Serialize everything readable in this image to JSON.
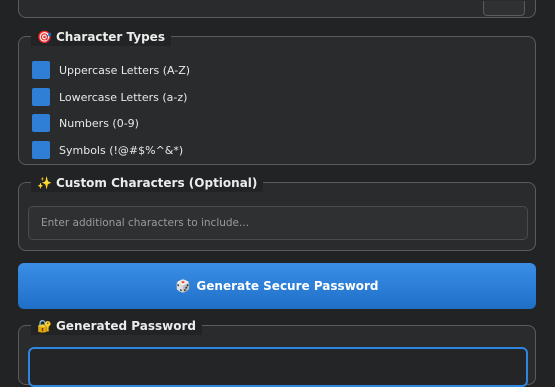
{
  "character_types": {
    "icon": "🎯",
    "title": "Character Types",
    "options": [
      {
        "label": "Uppercase Letters (A-Z)",
        "checked": true
      },
      {
        "label": "Lowercase Letters (a-z)",
        "checked": true
      },
      {
        "label": "Numbers (0-9)",
        "checked": true
      },
      {
        "label": "Symbols (!@#$%^&*)",
        "checked": true
      }
    ]
  },
  "custom_characters": {
    "icon": "✨",
    "title": "Custom Characters (Optional)",
    "placeholder": "Enter additional characters to include...",
    "value": ""
  },
  "generate_button": {
    "icon": "🎲",
    "label": "Generate Secure Password"
  },
  "generated_password": {
    "icon": "🔐",
    "title": "Generated Password",
    "value": ""
  },
  "colors": {
    "accent": "#2f7fd6",
    "background": "#222324",
    "panel_border": "#5a5b5d"
  }
}
